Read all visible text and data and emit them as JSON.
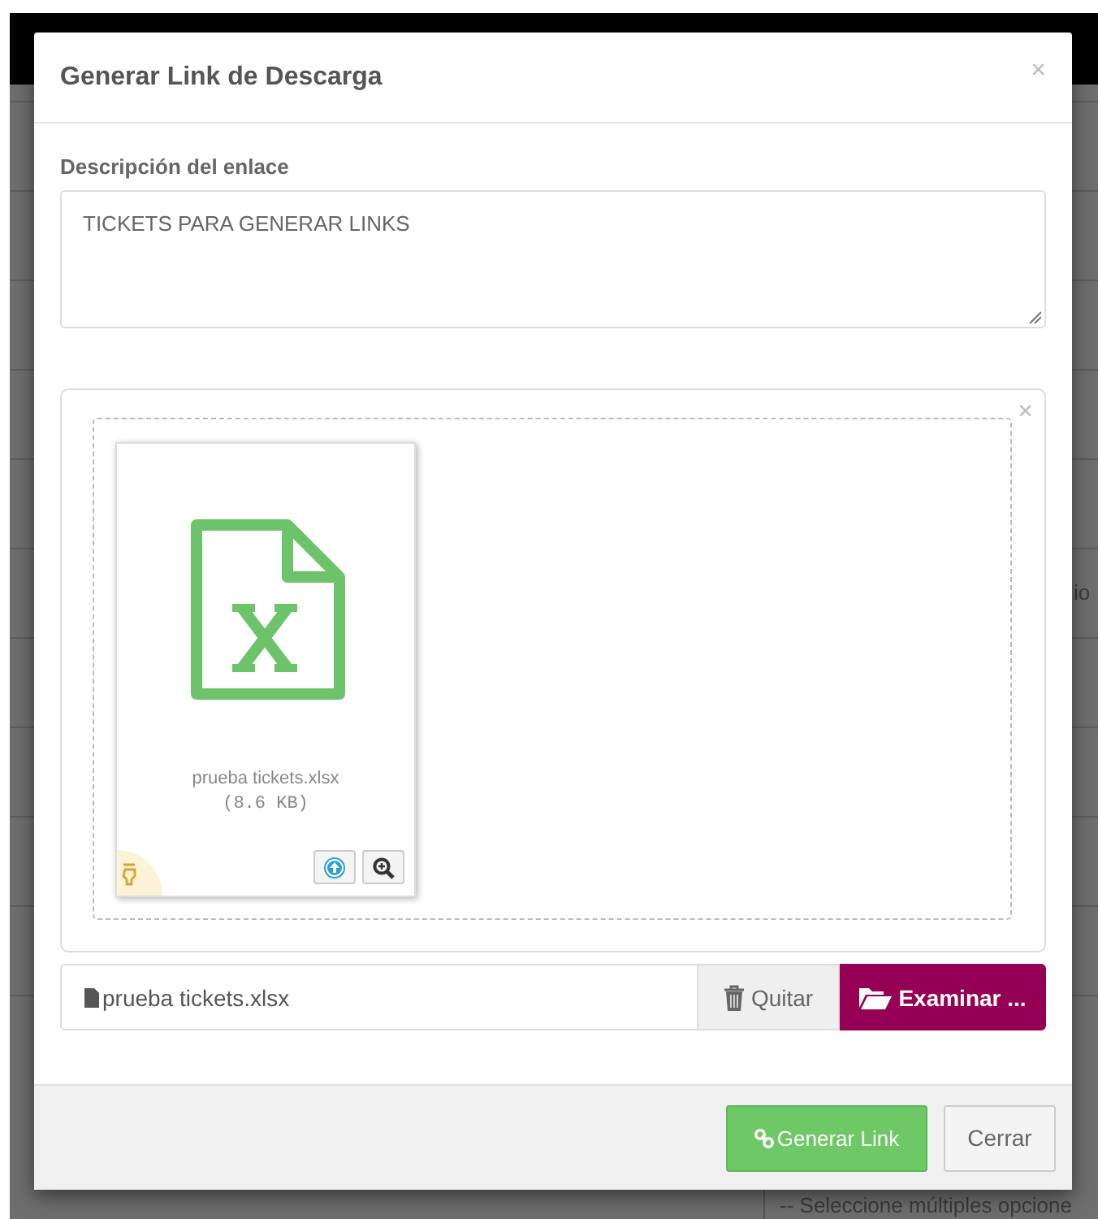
{
  "dialog": {
    "title": "Generar Link de Descarga",
    "close": "×"
  },
  "description": {
    "label": "Descripción del enlace",
    "value": "TICKETS PARA GENERAR LINKS"
  },
  "preview": {
    "close": "×",
    "files": [
      {
        "name": "prueba tickets.xlsx",
        "size": "(8.6 KB)"
      }
    ]
  },
  "file_input": {
    "value": "prueba tickets.xlsx",
    "buttons": [
      {
        "kind": "remove",
        "label": "Quitar"
      },
      {
        "kind": "browse",
        "label": "Examinar ..."
      }
    ]
  },
  "footer_buttons": [
    {
      "kind": "primary",
      "label": "Generar Link"
    },
    {
      "kind": "default",
      "label": "Cerrar"
    }
  ],
  "background": {
    "texts": [
      "io",
      "-- Seleccione múltiples opcione"
    ]
  }
}
